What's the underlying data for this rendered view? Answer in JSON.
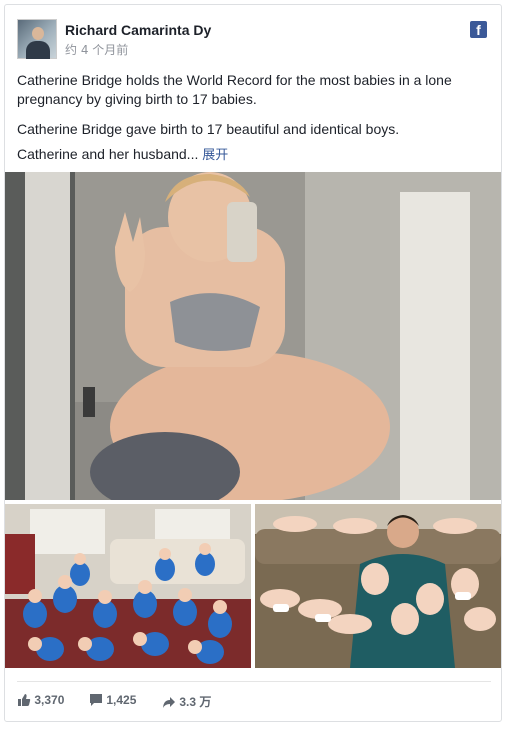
{
  "post": {
    "author": "Richard Camarinta Dy",
    "timestamp": "约 4 个月前",
    "platform_icon": "f",
    "paragraphs": [
      "Catherine Bridge holds the World Record for the most babies in a lone pregnancy by giving birth to 17 babies.",
      "Catherine Bridge gave birth to 17 beautiful and identical boys.",
      "Catherine and her husband..."
    ],
    "see_more": "展开"
  },
  "stats": {
    "likes": "3,370",
    "comments": "1,425",
    "shares": "3.3 万"
  },
  "colors": {
    "facebook_blue": "#3b5998",
    "link": "#365899",
    "text": "#1d2129",
    "muted": "#90949c"
  }
}
